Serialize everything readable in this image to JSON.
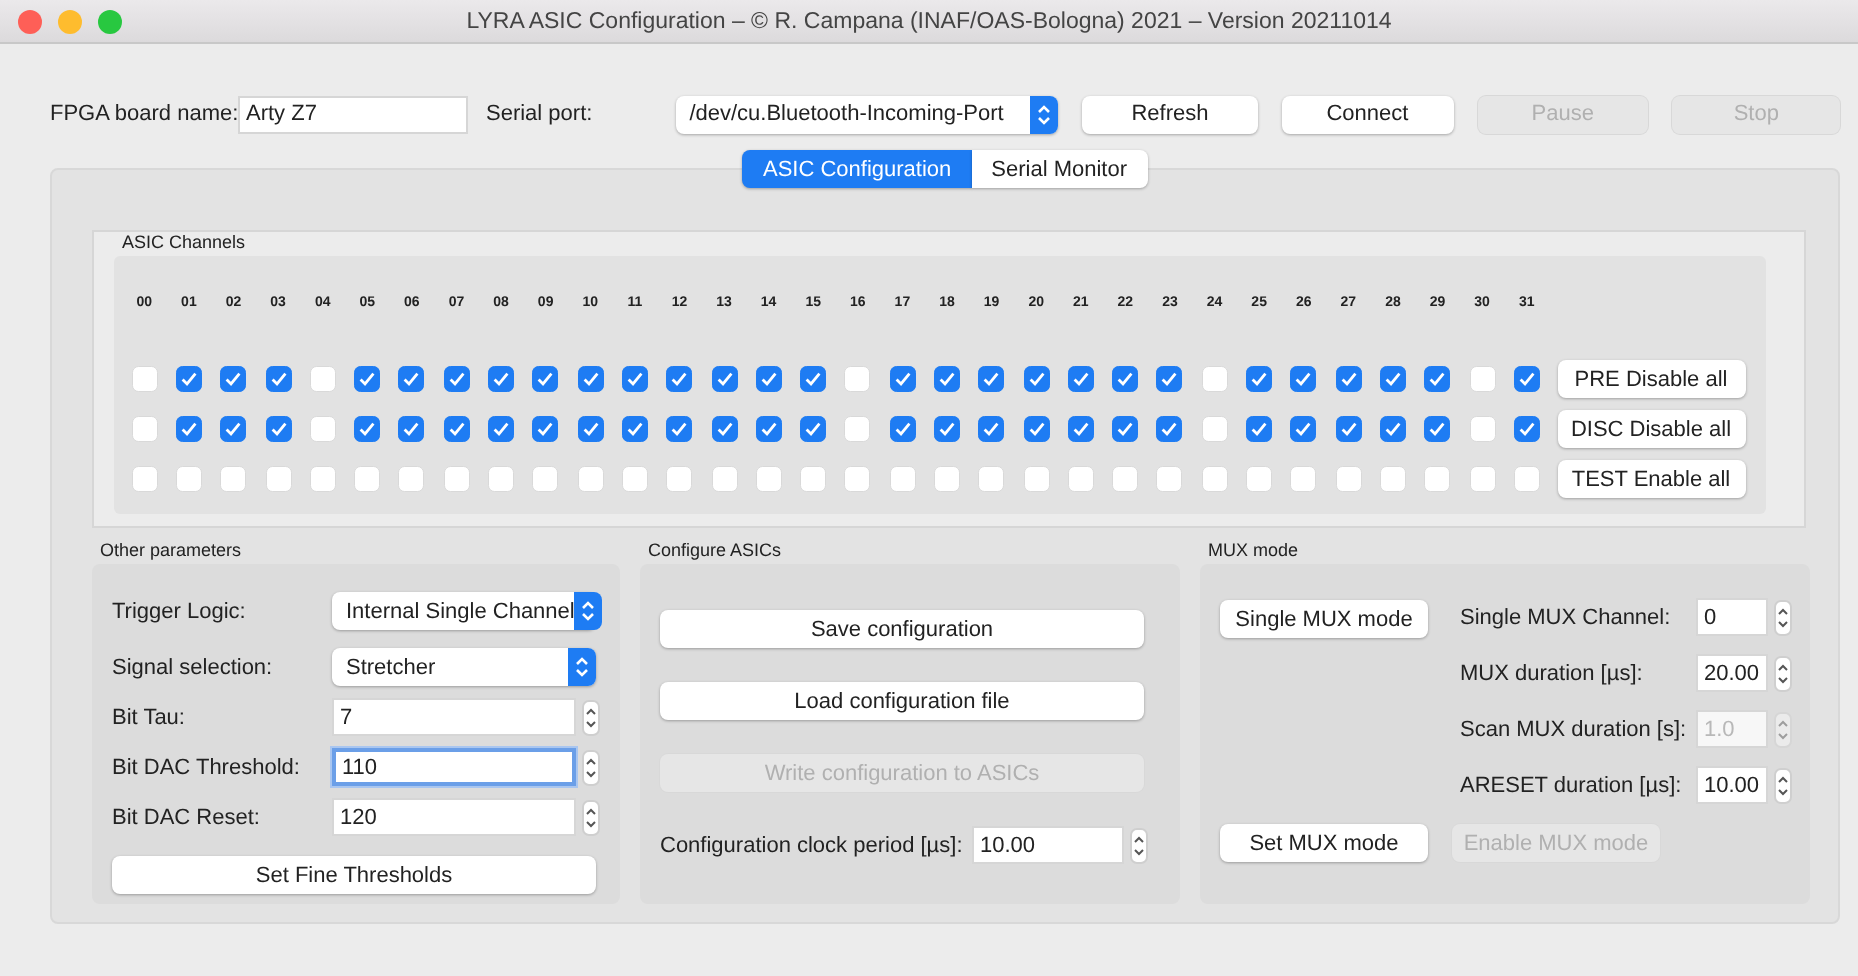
{
  "window": {
    "title": "LYRA ASIC Configuration – © R. Campana (INAF/OAS-Bologna) 2021 – Version 20211014"
  },
  "connection": {
    "board_label": "FPGA board name:",
    "board_value": "Arty Z7",
    "port_label": "Serial port:",
    "port_value": "/dev/cu.Bluetooth-Incoming-Port",
    "buttons": [
      {
        "label": "Refresh",
        "disabled": false
      },
      {
        "label": "Connect",
        "disabled": false
      },
      {
        "label": "Pause",
        "disabled": true
      },
      {
        "label": "Stop",
        "disabled": true
      }
    ]
  },
  "tabs": [
    {
      "label": "ASIC Configuration",
      "selected": true
    },
    {
      "label": "Serial Monitor",
      "selected": false
    }
  ],
  "asic_channels": {
    "title": "ASIC Channels",
    "channels": [
      "00",
      "01",
      "02",
      "03",
      "04",
      "05",
      "06",
      "07",
      "08",
      "09",
      "10",
      "11",
      "12",
      "13",
      "14",
      "15",
      "16",
      "17",
      "18",
      "19",
      "20",
      "21",
      "22",
      "23",
      "24",
      "25",
      "26",
      "27",
      "28",
      "29",
      "30",
      "31"
    ],
    "rows": [
      {
        "button": "PRE Disable all",
        "checked": [
          false,
          true,
          true,
          true,
          false,
          true,
          true,
          true,
          true,
          true,
          true,
          true,
          true,
          true,
          true,
          true,
          false,
          true,
          true,
          true,
          true,
          true,
          true,
          true,
          false,
          true,
          true,
          true,
          true,
          true,
          false,
          true
        ]
      },
      {
        "button": "DISC Disable all",
        "checked": [
          false,
          true,
          true,
          true,
          false,
          true,
          true,
          true,
          true,
          true,
          true,
          true,
          true,
          true,
          true,
          true,
          false,
          true,
          true,
          true,
          true,
          true,
          true,
          true,
          false,
          true,
          true,
          true,
          true,
          true,
          false,
          true
        ]
      },
      {
        "button": "TEST Enable all",
        "checked": [
          false,
          false,
          false,
          false,
          false,
          false,
          false,
          false,
          false,
          false,
          false,
          false,
          false,
          false,
          false,
          false,
          false,
          false,
          false,
          false,
          false,
          false,
          false,
          false,
          false,
          false,
          false,
          false,
          false,
          false,
          false,
          false
        ]
      }
    ]
  },
  "other_parameters": {
    "title": "Other parameters",
    "fields": [
      {
        "kind": "select",
        "label": "Trigger Logic:",
        "value": "Internal Single Channel"
      },
      {
        "kind": "select",
        "label": "Signal selection:",
        "value": "Stretcher"
      },
      {
        "kind": "spin",
        "label": "Bit Tau:",
        "value": "7",
        "focused": false
      },
      {
        "kind": "spin",
        "label": "Bit DAC Threshold:",
        "value": "110",
        "focused": true
      },
      {
        "kind": "spin",
        "label": "Bit DAC Reset:",
        "value": "120",
        "focused": false
      }
    ],
    "button": "Set Fine Thresholds"
  },
  "configure_asics": {
    "title": "Configure ASICs",
    "buttons": [
      {
        "label": "Save configuration",
        "disabled": false
      },
      {
        "label": "Load configuration file",
        "disabled": false
      },
      {
        "label": "Write configuration to ASICs",
        "disabled": true
      }
    ],
    "clock": {
      "label": "Configuration clock period [µs]:",
      "value": "10.00"
    }
  },
  "mux_mode": {
    "title": "MUX mode",
    "mode_button": {
      "label": "Single MUX mode",
      "disabled": false
    },
    "fields": [
      {
        "label": "Single MUX Channel:",
        "value": "0",
        "disabled": false
      },
      {
        "label": "MUX duration [µs]:",
        "value": "20.00",
        "disabled": false
      },
      {
        "label": "Scan MUX duration [s]:",
        "value": "1.0",
        "disabled": true
      },
      {
        "label": "ARESET duration [µs]:",
        "value": "10.00",
        "disabled": false
      }
    ],
    "buttons": [
      {
        "label": "Set MUX mode",
        "disabled": false
      },
      {
        "label": "Enable MUX mode",
        "disabled": true
      }
    ]
  }
}
